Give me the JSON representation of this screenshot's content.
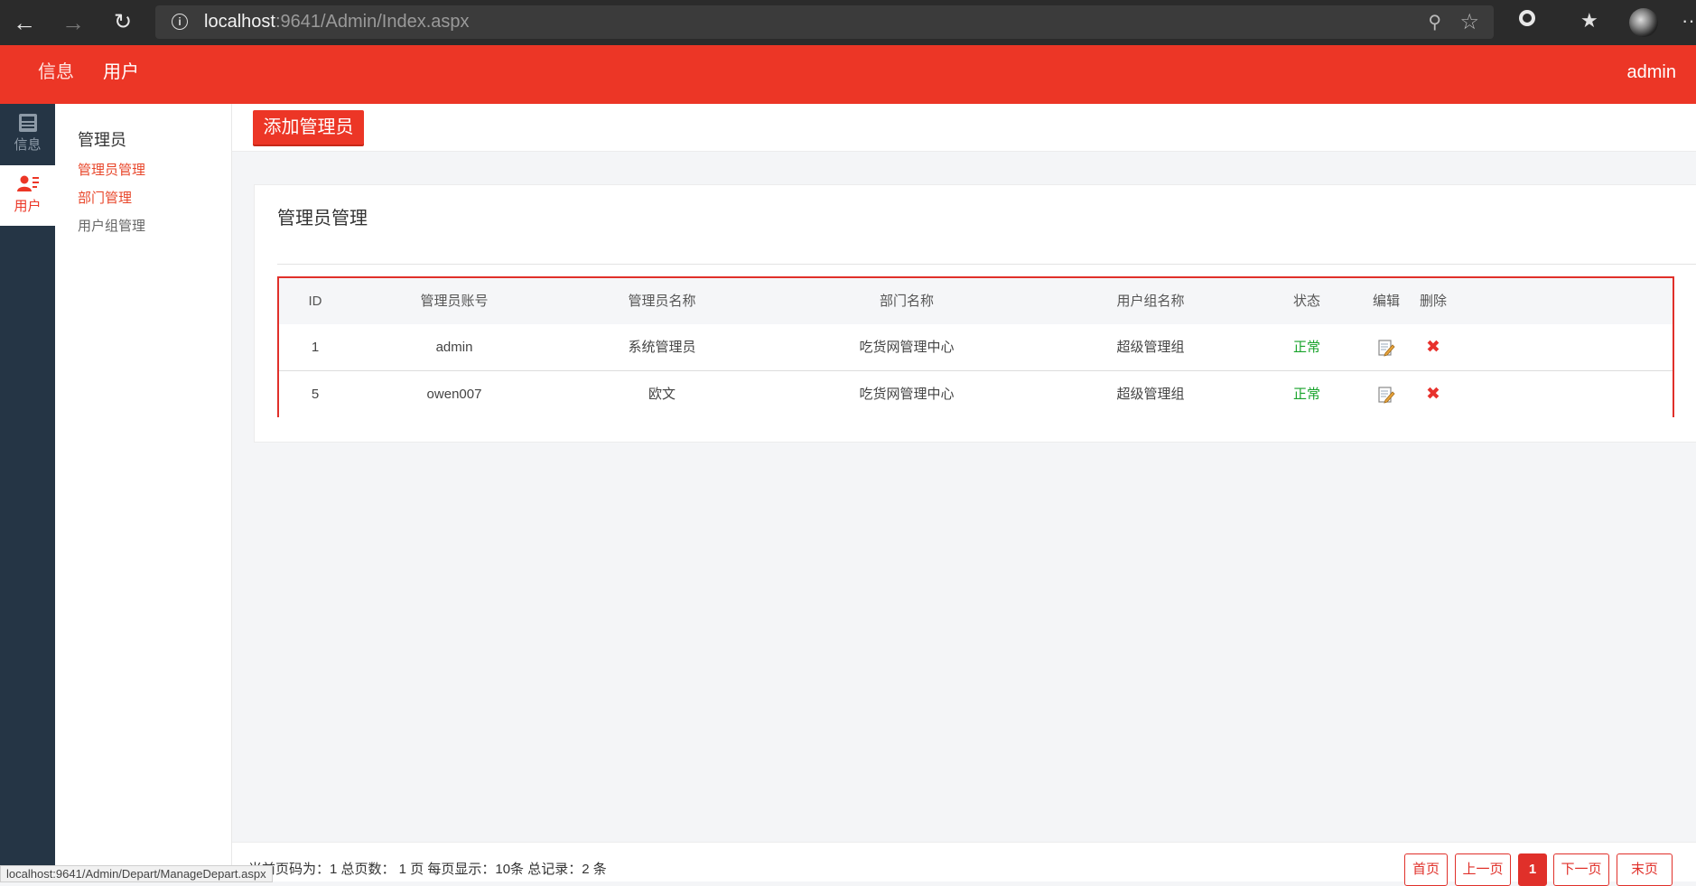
{
  "browser": {
    "url_host": "localhost",
    "url_rest": ":9641/Admin/Index.aspx",
    "status_url": "localhost:9641/Admin/Depart/ManageDepart.aspx"
  },
  "topbar": {
    "nav": [
      "信息",
      "用户"
    ],
    "user": "admin",
    "brand_color": "#ec3626"
  },
  "iconbar": {
    "items": [
      {
        "label": "信息",
        "icon": "news-icon"
      },
      {
        "label": "用户",
        "icon": "user-list-icon"
      }
    ]
  },
  "menu": {
    "title": "管理员",
    "items": [
      "管理员管理",
      "部门管理",
      "用户组管理"
    ]
  },
  "toolbar": {
    "add_label": "添加管理员"
  },
  "panel": {
    "title": "管理员管理"
  },
  "table": {
    "headers": [
      "ID",
      "管理员账号",
      "管理员名称",
      "部门名称",
      "用户组名称",
      "状态",
      "编辑",
      "删除"
    ],
    "rows": [
      {
        "id": "1",
        "account": "admin",
        "name": "系统管理员",
        "dept": "吃货网管理中心",
        "group": "超级管理组",
        "status": "正常"
      },
      {
        "id": "5",
        "account": "owen007",
        "name": "欧文",
        "dept": "吃货网管理中心",
        "group": "超级管理组",
        "status": "正常"
      }
    ]
  },
  "footer": {
    "summary": "当前页码为：1 总页数： 1 页 每页显示：10条 总记录：2 条",
    "pager": [
      "首页",
      "上一页",
      "1",
      "下一页",
      "末页"
    ]
  }
}
